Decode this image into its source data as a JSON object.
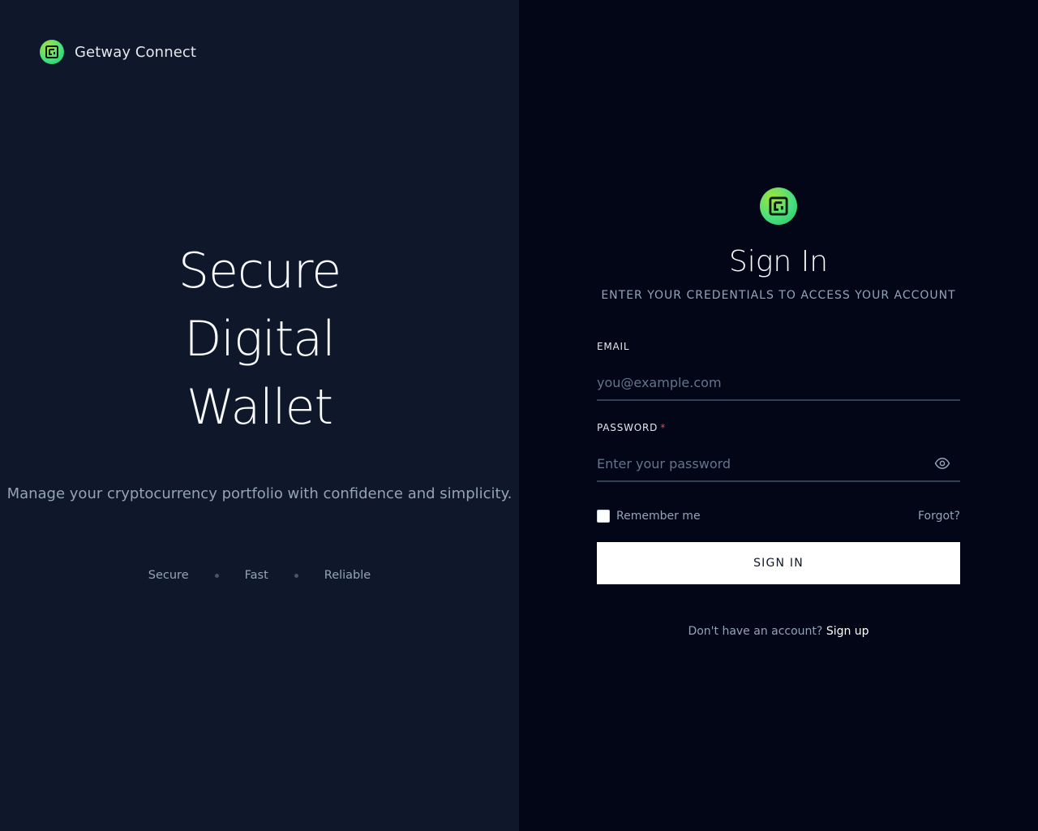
{
  "brand": {
    "name": "Getway Connect"
  },
  "hero": {
    "lines": [
      "Secure",
      "Digital",
      "Wallet"
    ],
    "description": "Manage your cryptocurrency portfolio with confidence and simplicity.",
    "features": [
      "Secure",
      "Fast",
      "Reliable"
    ]
  },
  "signin": {
    "title": "Sign In",
    "subtitle": "Enter your credentials to access your account",
    "email_label": "Email",
    "email_placeholder": "you@example.com",
    "password_label": "Password",
    "required_mark": "*",
    "password_placeholder": "Enter your password",
    "remember_label": "Remember me",
    "forgot_label": "Forgot?",
    "submit_label": "Sign In",
    "signup_prompt": "Don't have an account?",
    "signup_link": "Sign up"
  },
  "icons": {
    "logo": "getway-logo-icon",
    "show_password": "eye-icon"
  },
  "colors": {
    "left_bg": "#0f172a",
    "right_bg": "#020617",
    "accent": "#4ade80",
    "required": "#ef4444"
  }
}
